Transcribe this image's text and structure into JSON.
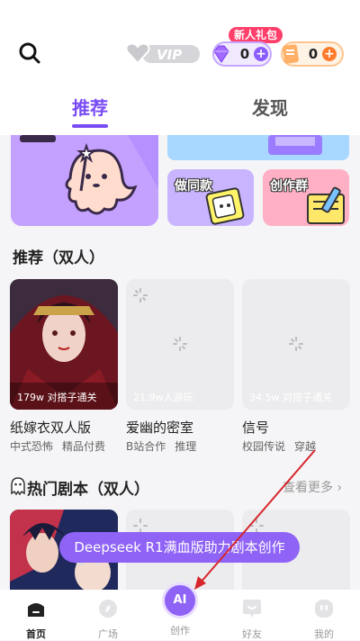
{
  "header": {
    "vip_text": "VIP",
    "gift_tag": "新人礼包",
    "purple_count": "0",
    "orange_count": "0",
    "plus": "+"
  },
  "tabs": [
    {
      "label": "推荐"
    },
    {
      "label": "发现"
    }
  ],
  "banners": {
    "same_style": "做同款",
    "create_group": "创作群"
  },
  "section1": {
    "title": "推荐（双人）",
    "games": [
      {
        "plays": "179w 对搭子通关",
        "title": "纸嫁衣双人版",
        "tags": [
          "中式恐怖",
          "精品付费"
        ]
      },
      {
        "plays": "21.9w人游玩",
        "title": "爱幽的密室",
        "tags": [
          "B站合作",
          "推理"
        ]
      },
      {
        "plays": "34.5w 对搭子通关",
        "title": "信号",
        "tags": [
          "校园传说",
          "穿越"
        ]
      }
    ]
  },
  "section2": {
    "title": "热门剧本（双人）",
    "more": "查看更多 ›"
  },
  "promo": "Deepseek R1满血版助力剧本创作",
  "nav": {
    "home": "首页",
    "square": "广场",
    "create_ai": "AI",
    "create": "创作",
    "friends": "好友",
    "mine": "我的"
  },
  "colors": {
    "accent": "#7a4cf5",
    "purple_button": "#8f63f5",
    "gift_red": "#ff3f6a",
    "arrow_red": "#d7262b"
  }
}
